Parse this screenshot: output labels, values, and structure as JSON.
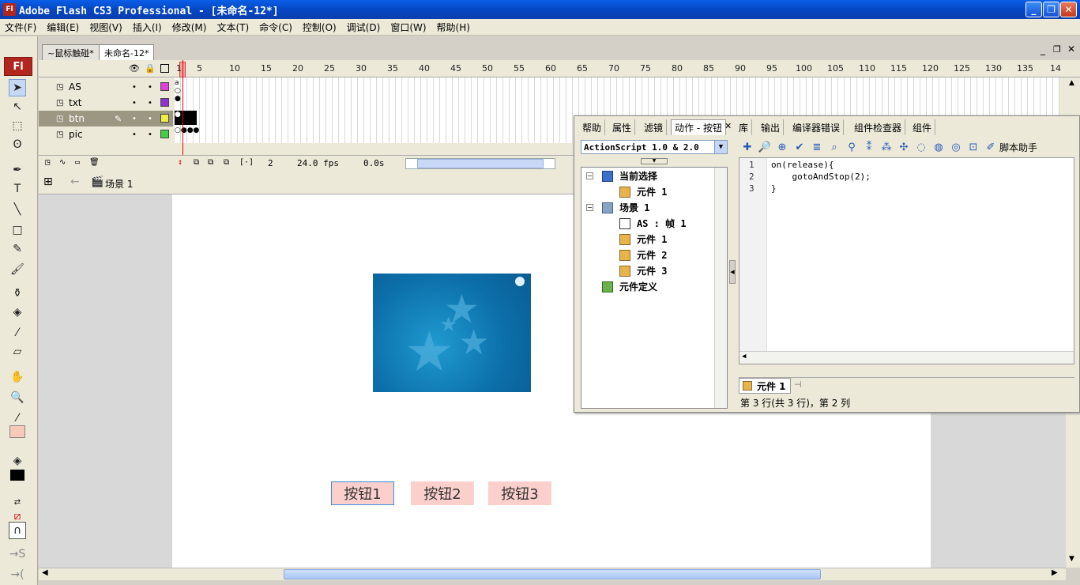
{
  "window": {
    "title": "Adobe Flash CS3 Professional - [未命名-12*]",
    "logo": "Fl"
  },
  "menu": [
    "文件(F)",
    "编辑(E)",
    "视图(V)",
    "插入(I)",
    "修改(M)",
    "文本(T)",
    "命令(C)",
    "控制(O)",
    "调试(D)",
    "窗口(W)",
    "帮助(H)"
  ],
  "doc_tabs": [
    "~鼠标触碰*",
    "未命名-12*"
  ],
  "tools": {
    "logo": "Fl"
  },
  "timeline": {
    "frame_numbers": [
      "1",
      "5",
      "10",
      "15",
      "20",
      "25",
      "30",
      "35",
      "40",
      "45",
      "50",
      "55",
      "60",
      "65",
      "70",
      "75",
      "80",
      "85",
      "90",
      "95",
      "100",
      "105",
      "110",
      "115",
      "120",
      "125",
      "130",
      "135",
      "14"
    ],
    "layers": [
      {
        "name": "AS",
        "color": "#e040e0"
      },
      {
        "name": "txt",
        "color": "#9030d0"
      },
      {
        "name": "btn",
        "color": "#f0f040"
      },
      {
        "name": "pic",
        "color": "#40d040"
      }
    ],
    "current_frame": "2",
    "fps": "24.0 fps",
    "time": "0.0s"
  },
  "scene": {
    "name": "场景 1"
  },
  "stage": {
    "buttons": [
      "按钮1",
      "按钮2",
      "按钮3"
    ]
  },
  "actions_panel": {
    "tabs": [
      "帮助",
      "属性",
      "滤镜",
      "动作 - 按钮",
      "库",
      "输出",
      "编译器错误",
      "组件检查器",
      "组件"
    ],
    "language": "ActionScript 1.0 & 2.0",
    "tree": {
      "current_selection": "当前选择",
      "current_item": "元件 1",
      "scene": "场景 1",
      "scene_items": [
        "AS : 帧 1",
        "元件 1",
        "元件 2",
        "元件 3"
      ],
      "symbol_defs": "元件定义"
    },
    "toolbar_label": "脚本助手",
    "code": {
      "lines": [
        "1",
        "2",
        "3"
      ],
      "text": [
        "on(release){",
        "    gotoAndStop(2);",
        "}"
      ]
    },
    "script_nav": "元件 1",
    "status": "第 3 行(共 3 行)，第 2 列"
  }
}
